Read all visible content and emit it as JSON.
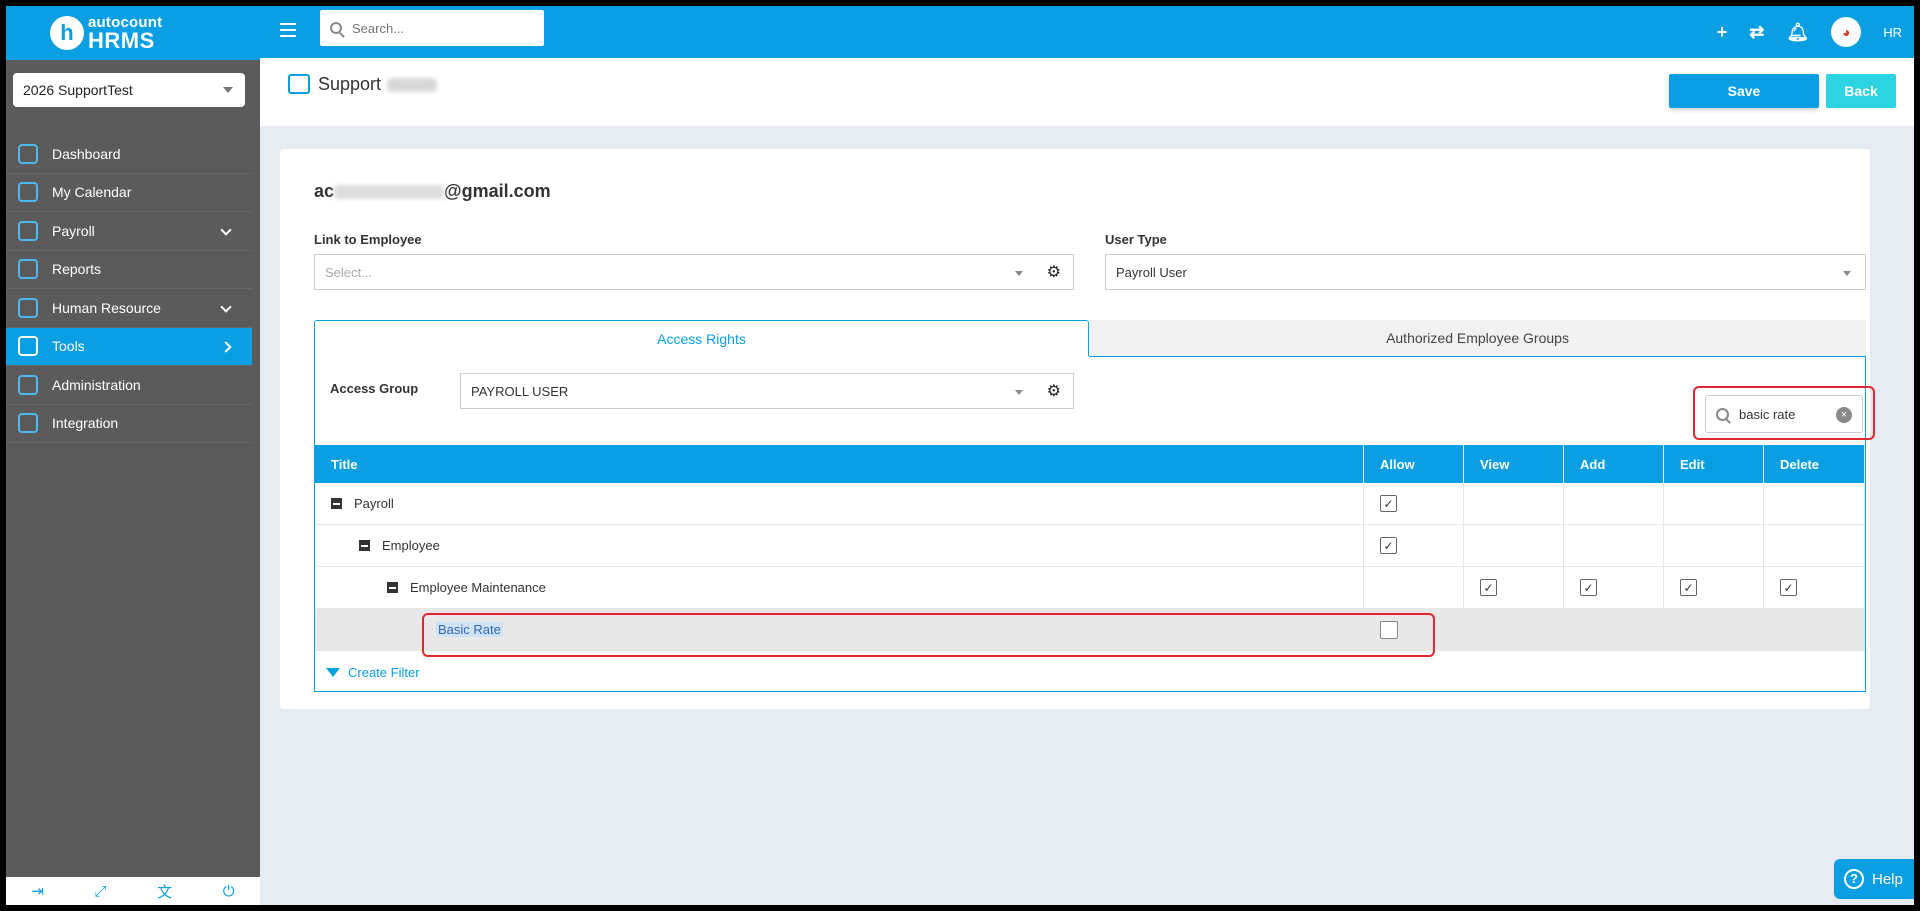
{
  "brand": {
    "logo_letter": "h",
    "line1": "autocount",
    "line2": "HRMS"
  },
  "company": {
    "selected": "2026 SupportTest"
  },
  "nav": [
    {
      "label": "Dashboard"
    },
    {
      "label": "My Calendar"
    },
    {
      "label": "Payroll"
    },
    {
      "label": "Reports"
    },
    {
      "label": "Human Resource"
    },
    {
      "label": "Tools"
    },
    {
      "label": "Administration"
    },
    {
      "label": "Integration"
    }
  ],
  "topbar": {
    "search_placeholder": "Search...",
    "user_label": "HR"
  },
  "page": {
    "title": "Support",
    "save_label": "Save",
    "back_label": "Back"
  },
  "form": {
    "email_prefix": "ac",
    "email_suffix": "@gmail.com",
    "link_employee_label": "Link to Employee",
    "link_employee_placeholder": "Select...",
    "user_type_label": "User Type",
    "user_type_value": "Payroll User"
  },
  "tabs": [
    {
      "label": "Access Rights"
    },
    {
      "label": "Authorized Employee Groups"
    }
  ],
  "access": {
    "group_label": "Access Group",
    "group_value": "PAYROLL USER",
    "filter_value": "basic rate"
  },
  "grid": {
    "columns": [
      "Title",
      "Allow",
      "View",
      "Add",
      "Edit",
      "Delete"
    ],
    "rows": [
      {
        "title": "Payroll",
        "level": 0,
        "allow": true
      },
      {
        "title": "Employee",
        "level": 1,
        "allow": true
      },
      {
        "title": "Employee Maintenance",
        "level": 2,
        "view": true,
        "add": true,
        "edit": true,
        "delete": true
      },
      {
        "title": "Basic Rate",
        "level": 3,
        "allow": false
      }
    ]
  },
  "footer": {
    "create_filter": "Create Filter",
    "help": "Help"
  },
  "colors": {
    "accent": "#0a9ee3",
    "sidebar": "#5b5b5b",
    "highlight": "#e0262f"
  }
}
